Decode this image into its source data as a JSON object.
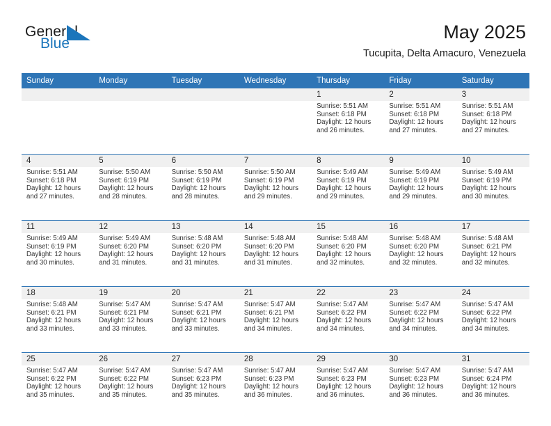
{
  "brand": {
    "name_part1": "General",
    "name_part2": "Blue",
    "flag_icon": "blue-flag-icon",
    "accent_color": "#1b75bb"
  },
  "header": {
    "title": "May 2025",
    "subtitle": "Tucupita, Delta Amacuro, Venezuela"
  },
  "theme": {
    "header_blue": "#2e75b6",
    "daynum_band": "#f0f0f0",
    "text": "#333333"
  },
  "weekday_headers": [
    "Sunday",
    "Monday",
    "Tuesday",
    "Wednesday",
    "Thursday",
    "Friday",
    "Saturday"
  ],
  "weeks": [
    [
      {
        "day": "",
        "lines": [
          "",
          "",
          "",
          ""
        ]
      },
      {
        "day": "",
        "lines": [
          "",
          "",
          "",
          ""
        ]
      },
      {
        "day": "",
        "lines": [
          "",
          "",
          "",
          ""
        ]
      },
      {
        "day": "",
        "lines": [
          "",
          "",
          "",
          ""
        ]
      },
      {
        "day": "1",
        "lines": [
          "Sunrise: 5:51 AM",
          "Sunset: 6:18 PM",
          "Daylight: 12 hours",
          "and 26 minutes."
        ]
      },
      {
        "day": "2",
        "lines": [
          "Sunrise: 5:51 AM",
          "Sunset: 6:18 PM",
          "Daylight: 12 hours",
          "and 27 minutes."
        ]
      },
      {
        "day": "3",
        "lines": [
          "Sunrise: 5:51 AM",
          "Sunset: 6:18 PM",
          "Daylight: 12 hours",
          "and 27 minutes."
        ]
      }
    ],
    [
      {
        "day": "4",
        "lines": [
          "Sunrise: 5:51 AM",
          "Sunset: 6:18 PM",
          "Daylight: 12 hours",
          "and 27 minutes."
        ]
      },
      {
        "day": "5",
        "lines": [
          "Sunrise: 5:50 AM",
          "Sunset: 6:19 PM",
          "Daylight: 12 hours",
          "and 28 minutes."
        ]
      },
      {
        "day": "6",
        "lines": [
          "Sunrise: 5:50 AM",
          "Sunset: 6:19 PM",
          "Daylight: 12 hours",
          "and 28 minutes."
        ]
      },
      {
        "day": "7",
        "lines": [
          "Sunrise: 5:50 AM",
          "Sunset: 6:19 PM",
          "Daylight: 12 hours",
          "and 29 minutes."
        ]
      },
      {
        "day": "8",
        "lines": [
          "Sunrise: 5:49 AM",
          "Sunset: 6:19 PM",
          "Daylight: 12 hours",
          "and 29 minutes."
        ]
      },
      {
        "day": "9",
        "lines": [
          "Sunrise: 5:49 AM",
          "Sunset: 6:19 PM",
          "Daylight: 12 hours",
          "and 29 minutes."
        ]
      },
      {
        "day": "10",
        "lines": [
          "Sunrise: 5:49 AM",
          "Sunset: 6:19 PM",
          "Daylight: 12 hours",
          "and 30 minutes."
        ]
      }
    ],
    [
      {
        "day": "11",
        "lines": [
          "Sunrise: 5:49 AM",
          "Sunset: 6:19 PM",
          "Daylight: 12 hours",
          "and 30 minutes."
        ]
      },
      {
        "day": "12",
        "lines": [
          "Sunrise: 5:49 AM",
          "Sunset: 6:20 PM",
          "Daylight: 12 hours",
          "and 31 minutes."
        ]
      },
      {
        "day": "13",
        "lines": [
          "Sunrise: 5:48 AM",
          "Sunset: 6:20 PM",
          "Daylight: 12 hours",
          "and 31 minutes."
        ]
      },
      {
        "day": "14",
        "lines": [
          "Sunrise: 5:48 AM",
          "Sunset: 6:20 PM",
          "Daylight: 12 hours",
          "and 31 minutes."
        ]
      },
      {
        "day": "15",
        "lines": [
          "Sunrise: 5:48 AM",
          "Sunset: 6:20 PM",
          "Daylight: 12 hours",
          "and 32 minutes."
        ]
      },
      {
        "day": "16",
        "lines": [
          "Sunrise: 5:48 AM",
          "Sunset: 6:20 PM",
          "Daylight: 12 hours",
          "and 32 minutes."
        ]
      },
      {
        "day": "17",
        "lines": [
          "Sunrise: 5:48 AM",
          "Sunset: 6:21 PM",
          "Daylight: 12 hours",
          "and 32 minutes."
        ]
      }
    ],
    [
      {
        "day": "18",
        "lines": [
          "Sunrise: 5:48 AM",
          "Sunset: 6:21 PM",
          "Daylight: 12 hours",
          "and 33 minutes."
        ]
      },
      {
        "day": "19",
        "lines": [
          "Sunrise: 5:47 AM",
          "Sunset: 6:21 PM",
          "Daylight: 12 hours",
          "and 33 minutes."
        ]
      },
      {
        "day": "20",
        "lines": [
          "Sunrise: 5:47 AM",
          "Sunset: 6:21 PM",
          "Daylight: 12 hours",
          "and 33 minutes."
        ]
      },
      {
        "day": "21",
        "lines": [
          "Sunrise: 5:47 AM",
          "Sunset: 6:21 PM",
          "Daylight: 12 hours",
          "and 34 minutes."
        ]
      },
      {
        "day": "22",
        "lines": [
          "Sunrise: 5:47 AM",
          "Sunset: 6:22 PM",
          "Daylight: 12 hours",
          "and 34 minutes."
        ]
      },
      {
        "day": "23",
        "lines": [
          "Sunrise: 5:47 AM",
          "Sunset: 6:22 PM",
          "Daylight: 12 hours",
          "and 34 minutes."
        ]
      },
      {
        "day": "24",
        "lines": [
          "Sunrise: 5:47 AM",
          "Sunset: 6:22 PM",
          "Daylight: 12 hours",
          "and 34 minutes."
        ]
      }
    ],
    [
      {
        "day": "25",
        "lines": [
          "Sunrise: 5:47 AM",
          "Sunset: 6:22 PM",
          "Daylight: 12 hours",
          "and 35 minutes."
        ]
      },
      {
        "day": "26",
        "lines": [
          "Sunrise: 5:47 AM",
          "Sunset: 6:22 PM",
          "Daylight: 12 hours",
          "and 35 minutes."
        ]
      },
      {
        "day": "27",
        "lines": [
          "Sunrise: 5:47 AM",
          "Sunset: 6:23 PM",
          "Daylight: 12 hours",
          "and 35 minutes."
        ]
      },
      {
        "day": "28",
        "lines": [
          "Sunrise: 5:47 AM",
          "Sunset: 6:23 PM",
          "Daylight: 12 hours",
          "and 36 minutes."
        ]
      },
      {
        "day": "29",
        "lines": [
          "Sunrise: 5:47 AM",
          "Sunset: 6:23 PM",
          "Daylight: 12 hours",
          "and 36 minutes."
        ]
      },
      {
        "day": "30",
        "lines": [
          "Sunrise: 5:47 AM",
          "Sunset: 6:23 PM",
          "Daylight: 12 hours",
          "and 36 minutes."
        ]
      },
      {
        "day": "31",
        "lines": [
          "Sunrise: 5:47 AM",
          "Sunset: 6:24 PM",
          "Daylight: 12 hours",
          "and 36 minutes."
        ]
      }
    ]
  ]
}
